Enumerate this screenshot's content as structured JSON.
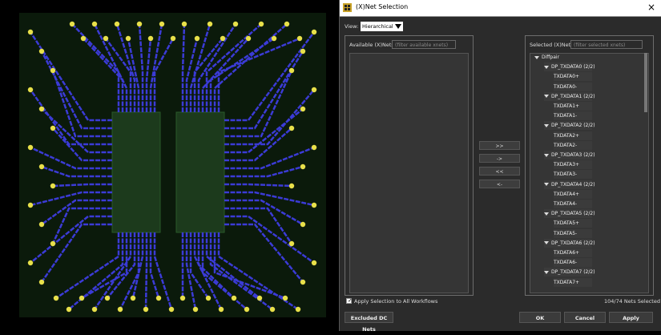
{
  "dialog": {
    "title": "(X)Net Selection",
    "close_icon": "×",
    "view_label": "View:",
    "view_value": "Hierarchical",
    "available": {
      "header": "Available (X)Nets",
      "filter_placeholder": "(filter available xnets)"
    },
    "selected": {
      "header": "Selected (X)Nets",
      "filter_placeholder": "(filter selected xnets)",
      "root": "Diffpair",
      "pairs": [
        {
          "name": "DP_TXDATA0 (2/2)",
          "children": [
            "TXDATA0+",
            "TXDATA0-"
          ]
        },
        {
          "name": "DP_TXDATA1 (2/2)",
          "children": [
            "TXDATA1+",
            "TXDATA1-"
          ]
        },
        {
          "name": "DP_TXDATA2 (2/2)",
          "children": [
            "TXDATA2+",
            "TXDATA2-"
          ]
        },
        {
          "name": "DP_TXDATA3 (2/2)",
          "children": [
            "TXDATA3+",
            "TXDATA3-"
          ]
        },
        {
          "name": "DP_TXDATA4 (2/2)",
          "children": [
            "TXDATA4+",
            "TXDATA4-"
          ]
        },
        {
          "name": "DP_TXDATA5 (2/2)",
          "children": [
            "TXDATA5+",
            "TXDATA5-"
          ]
        },
        {
          "name": "DP_TXDATA6 (2/2)",
          "children": [
            "TXDATA6+",
            "TXDATA6-"
          ]
        },
        {
          "name": "DP_TXDATA7 (2/2)",
          "children": [
            "TXDATA7+"
          ]
        }
      ]
    },
    "move_buttons": [
      ">>",
      "->",
      "<<",
      "<-"
    ],
    "apply_all_label": "Apply Selection to All Workflows",
    "apply_all_checked": true,
    "selected_count": "104/74 Nets Selected",
    "excluded_button": "Excluded DC Nets",
    "ok_button": "OK",
    "cancel_button": "Cancel",
    "apply_button": "Apply"
  },
  "colors": {
    "trace": "#3b3bd6",
    "pad": "#e8e04a",
    "board": "#0b1a0b",
    "chip": "#1c3a1c"
  }
}
